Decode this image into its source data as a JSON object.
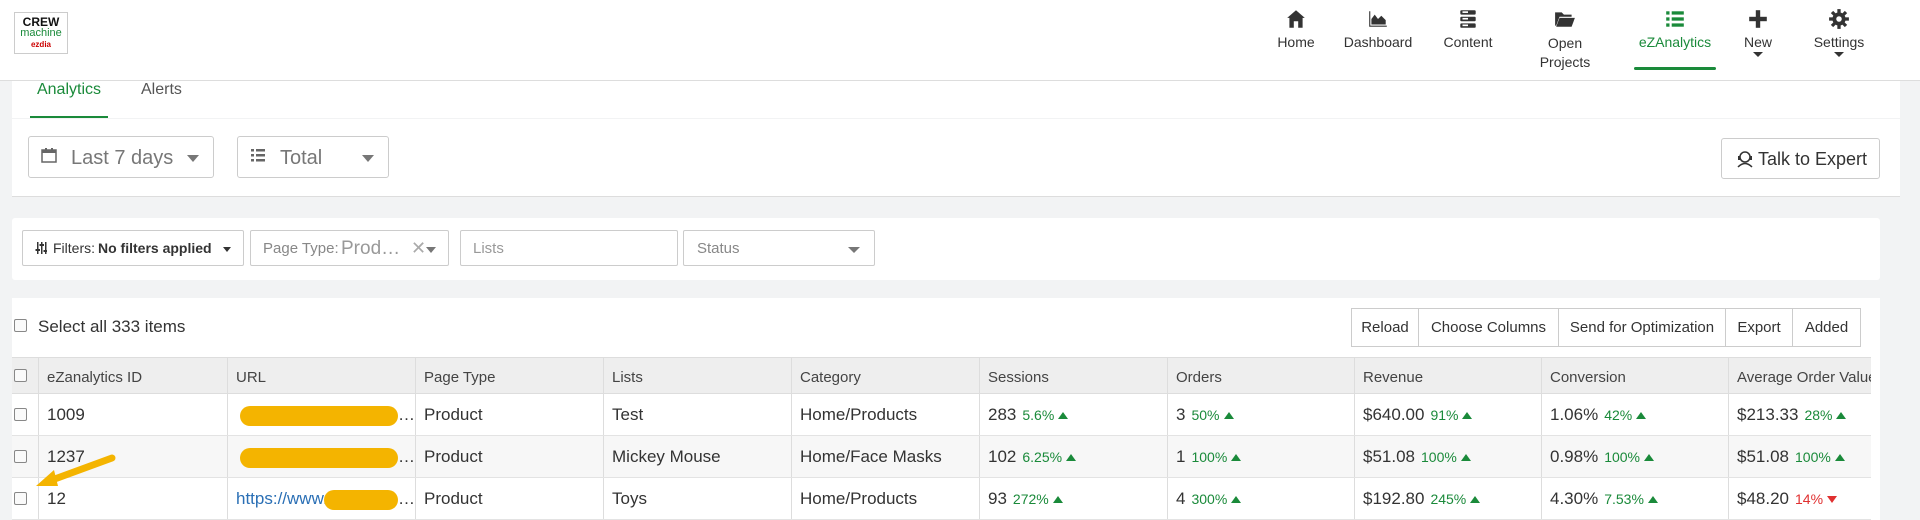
{
  "logo": {
    "line1": "CREW",
    "line2": "machine",
    "line3": "ezdia"
  },
  "nav": [
    {
      "label": "Home",
      "icon": "home-icon"
    },
    {
      "label": "Dashboard",
      "icon": "area-chart-icon"
    },
    {
      "label": "Content",
      "icon": "server-icon"
    },
    {
      "label": "Open Projects",
      "icon": "folder-open-icon"
    },
    {
      "label": "eZAnalytics",
      "icon": "list-icon"
    },
    {
      "label": "New",
      "icon": "plus-icon"
    },
    {
      "label": "Settings",
      "icon": "gear-icon"
    }
  ],
  "tabs": [
    {
      "label": "Analytics"
    },
    {
      "label": "Alerts"
    }
  ],
  "toolbar": {
    "date_range": "Last 7 days",
    "metric": "Total",
    "expert_label": "Talk to Expert"
  },
  "filters": {
    "filters_label": "Filters:",
    "filters_value": "No filters applied",
    "page_type_label": "Page Type:",
    "page_type_value": "Prod…",
    "lists_placeholder": "Lists",
    "status_placeholder": "Status"
  },
  "bulk": {
    "select_all": "Select all 333 items",
    "actions": [
      "Reload",
      "Choose Columns",
      "Send for Optimization",
      "Export",
      "Added"
    ]
  },
  "table": {
    "headers": [
      "eZanalytics ID",
      "URL",
      "Page Type",
      "Lists",
      "Category",
      "Sessions",
      "Orders",
      "Revenue",
      "Conversion",
      "Average Order Value"
    ],
    "rows": [
      {
        "id": "1009",
        "url": "",
        "page_type": "Product",
        "lists": "Test",
        "category": "Home/Products",
        "sessions": "283",
        "sessions_delta": "5.6%",
        "orders": "3",
        "orders_delta": "50%",
        "revenue": "$640.00",
        "revenue_delta": "91%",
        "conversion": "1.06%",
        "conversion_delta": "42%",
        "aov": "$213.33",
        "aov_delta": "28%",
        "aov_trend": "up"
      },
      {
        "id": "1237",
        "url": "",
        "page_type": "Product",
        "lists": "Mickey Mouse",
        "category": "Home/Face Masks",
        "sessions": "102",
        "sessions_delta": "6.25%",
        "orders": "1",
        "orders_delta": "100%",
        "revenue": "$51.08",
        "revenue_delta": "100%",
        "conversion": "0.98%",
        "conversion_delta": "100%",
        "aov": "$51.08",
        "aov_delta": "100%",
        "aov_trend": "up"
      },
      {
        "id": "12",
        "url": "https://www.",
        "page_type": "Product",
        "lists": "Toys",
        "category": "Home/Products",
        "sessions": "93",
        "sessions_delta": "272%",
        "orders": "4",
        "orders_delta": "300%",
        "revenue": "$192.80",
        "revenue_delta": "245%",
        "conversion": "4.30%",
        "conversion_delta": "7.53%",
        "aov": "$48.20",
        "aov_delta": "14%",
        "aov_trend": "down"
      }
    ]
  },
  "colors": {
    "accent": "#1a8a3a",
    "negative": "#e03030",
    "highlight": "#f4b400"
  }
}
